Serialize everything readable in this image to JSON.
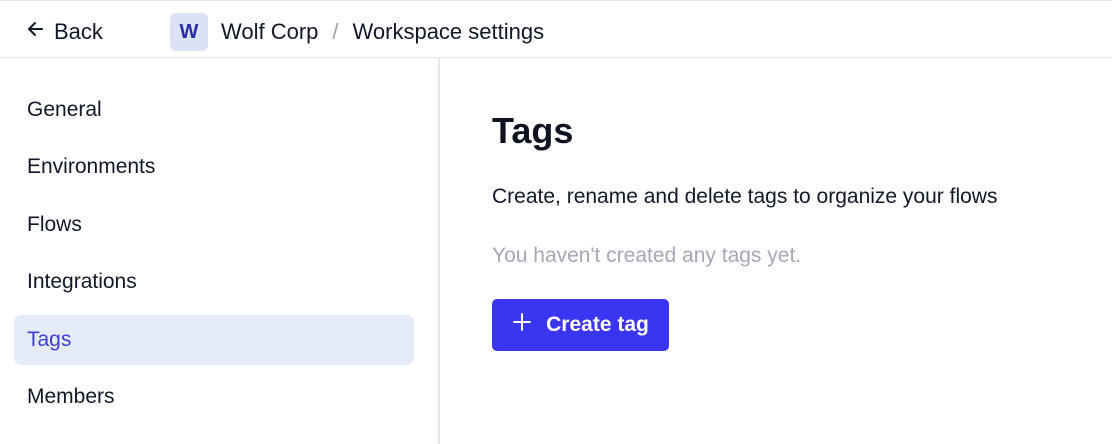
{
  "header": {
    "back_label": "Back",
    "back_icon": "arrow-left-icon",
    "workspace_initial": "W",
    "breadcrumb": {
      "org": "Wolf Corp",
      "separator": "/",
      "current": "Workspace settings"
    }
  },
  "sidebar": {
    "items": [
      {
        "label": "General",
        "active": false
      },
      {
        "label": "Environments",
        "active": false
      },
      {
        "label": "Flows",
        "active": false
      },
      {
        "label": "Integrations",
        "active": false
      },
      {
        "label": "Tags",
        "active": true
      },
      {
        "label": "Members",
        "active": false
      }
    ]
  },
  "main": {
    "title": "Tags",
    "description": "Create, rename and delete tags to organize your flows",
    "empty_state": "You haven't created any tags yet.",
    "create_button_label": "Create tag",
    "create_button_icon": "plus-icon"
  },
  "colors": {
    "accent": "#3a35f0",
    "active_nav_bg": "#e6ebf8",
    "active_nav_text": "#3b3fd8",
    "muted_text": "#a3a8b4",
    "avatar_bg": "#dbe2f5"
  }
}
